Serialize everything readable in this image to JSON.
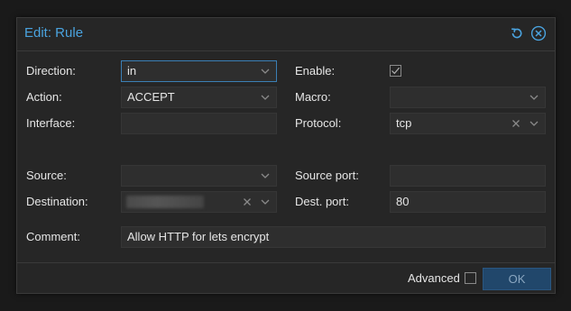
{
  "dialog": {
    "title": "Edit: Rule",
    "reset_icon": "reset-icon",
    "close_icon": "close-icon"
  },
  "form": {
    "direction": {
      "label": "Direction:",
      "value": "in"
    },
    "action": {
      "label": "Action:",
      "value": "ACCEPT"
    },
    "interface": {
      "label": "Interface:",
      "value": ""
    },
    "source": {
      "label": "Source:",
      "value": ""
    },
    "destination": {
      "label": "Destination:"
    },
    "comment": {
      "label": "Comment:",
      "value": "Allow HTTP for lets encrypt"
    },
    "enable": {
      "label": "Enable:",
      "checked": true
    },
    "macro": {
      "label": "Macro:",
      "value": ""
    },
    "protocol": {
      "label": "Protocol:",
      "value": "tcp"
    },
    "source_port": {
      "label": "Source port:",
      "value": ""
    },
    "dest_port": {
      "label": "Dest. port:",
      "value": "80"
    }
  },
  "footer": {
    "advanced_label": "Advanced",
    "advanced_checked": false,
    "ok_label": "OK"
  },
  "colors": {
    "accent": "#4aa3df",
    "background": "#262626",
    "field_bg": "#2e2e2e",
    "ok_button_bg": "#21476b"
  }
}
